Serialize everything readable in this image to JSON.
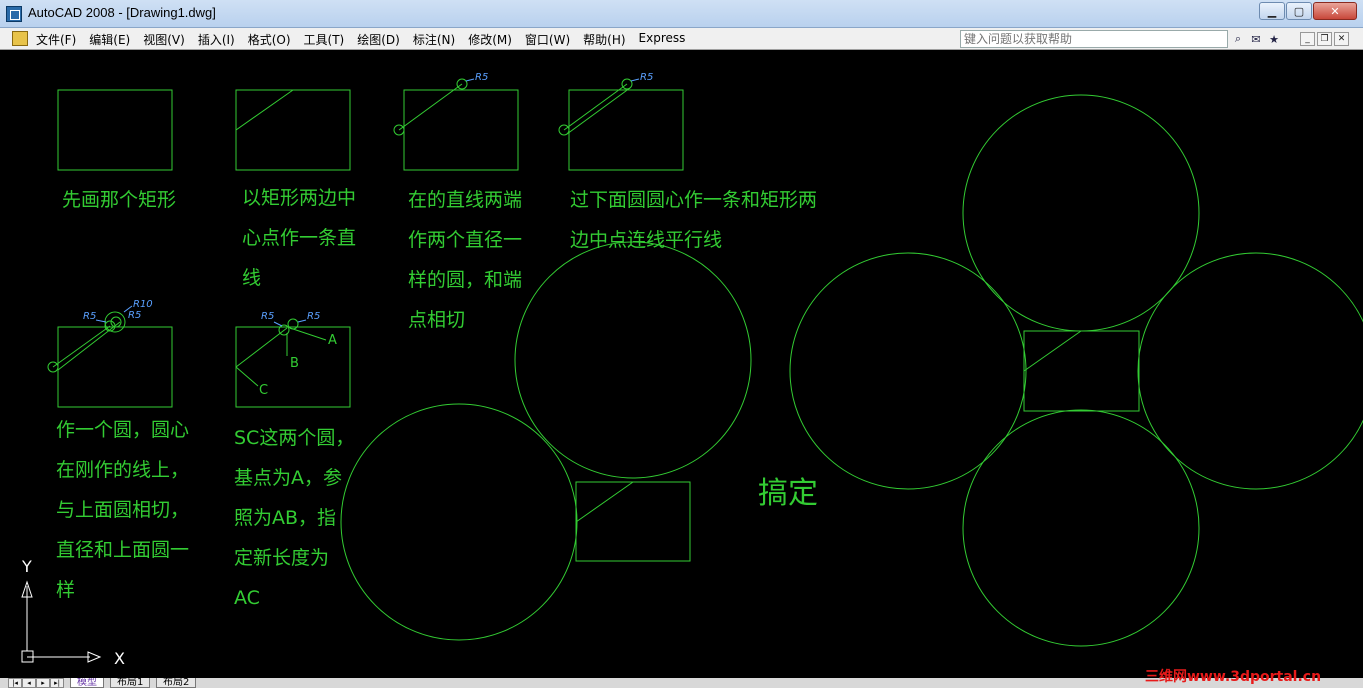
{
  "window": {
    "title": "AutoCAD 2008 - [Drawing1.dwg]"
  },
  "menu": {
    "items": [
      "文件(F)",
      "编辑(E)",
      "视图(V)",
      "插入(I)",
      "格式(O)",
      "工具(T)",
      "绘图(D)",
      "标注(N)",
      "修改(M)",
      "窗口(W)",
      "帮助(H)",
      "Express"
    ]
  },
  "help": {
    "placeholder": "键入问题以获取帮助"
  },
  "drawing": {
    "notes": [
      [
        "先画那个矩形"
      ],
      [
        "以矩形两边中",
        "心点作一条直",
        "线"
      ],
      [
        "在的直线两端",
        "作两个直径一",
        "样的圆，和端",
        "点相切"
      ],
      [
        "过下面圆圆心作一条和矩形两",
        "边中点连线平行线"
      ],
      [
        "作一个圆，圆心",
        "在刚作的线上，",
        "与上面圆相切，",
        "直径和上面圆一",
        "样"
      ],
      [
        "SC这两个圆，",
        "基点为A，参",
        "照为AB，指",
        "定新长度为",
        "AC"
      ],
      [
        "搞定"
      ]
    ],
    "dim_labels": {
      "r5": "R5",
      "r10": "R10",
      "a": "A",
      "b": "B",
      "c": "C"
    },
    "ucs": {
      "x": "X",
      "y": "Y"
    }
  },
  "layout_tabs": [
    "模型",
    "布局1",
    "布局2"
  ],
  "watermark": "三维网www.3dportal.cn",
  "colors": {
    "line": "#33cc33",
    "dim": "#5aa0ff",
    "background": "#000000"
  }
}
